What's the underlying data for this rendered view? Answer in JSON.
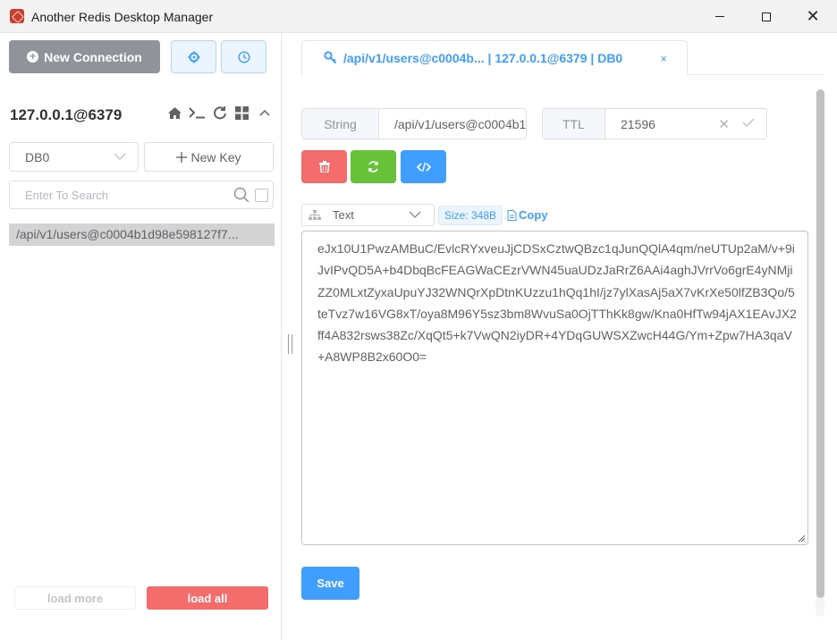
{
  "window": {
    "title": "Another Redis Desktop Manager",
    "minimize_icon": "minimize-icon",
    "maximize_icon": "maximize-icon",
    "close_glyph": "✕"
  },
  "sidebar": {
    "new_connection_label": "New Connection",
    "settings_icon": "gear-icon",
    "history_icon": "clock-icon",
    "connection_name": "127.0.0.1@6379",
    "connection_icons": [
      "home-icon",
      "terminal-icon",
      "refresh-icon",
      "grid-icon",
      "chevron-up-icon"
    ],
    "db_select_value": "DB0",
    "new_key_label": "New Key",
    "search_placeholder": "Enter To Search",
    "keys": [
      "/api/v1/users@c0004b1d98e598127f7..."
    ],
    "load_more_label": "load more",
    "load_all_label": "load all"
  },
  "tab": {
    "label": "/api/v1/users@c0004b... | 127.0.0.1@6379 | DB0",
    "close_glyph": "×"
  },
  "key_detail": {
    "type_label": "String",
    "key_name": "/api/v1/users@c0004b1d98e598127f7",
    "ttl_label": "TTL",
    "ttl_value": "21596",
    "format_value": "Text",
    "size_tag": "Size: 348B",
    "copy_label": "Copy",
    "value": "eJx10U1PwzAMBuC/EvlcRYxveuJjCDSxCztwQBzc1qJunQQlA4qm/neUTUp2aM/v+9iJvIPvQD5A+b4DbqBcFEAGWaCEzrVWN45uaUDzJaRrZ6AAi4aghJVrrVo6grE4yNMjiZZ0MLxtZyxaUpuYJ32WNQrXpDtnKUzzu1hQq1hI/jz7ylXasAj5aX7vKrXe50lfZB3Qo/5teTvz7w16VG8xT/oya8M96Y5sz3bm8WvuSa0OjTThKk8gw/Kna0HfTw94jAX1EAvJX2ff4A832rsws38Zc/XqQt5+k7VwQN2iyDR+4YDqGUWSXZwcH44G/Ym+Zpw7HA3qaV+A8WP8B2x60O0=",
    "save_label": "Save"
  },
  "colors": {
    "primary": "#409eff",
    "danger": "#f56c6c",
    "success": "#67c23a",
    "info": "#909399"
  }
}
